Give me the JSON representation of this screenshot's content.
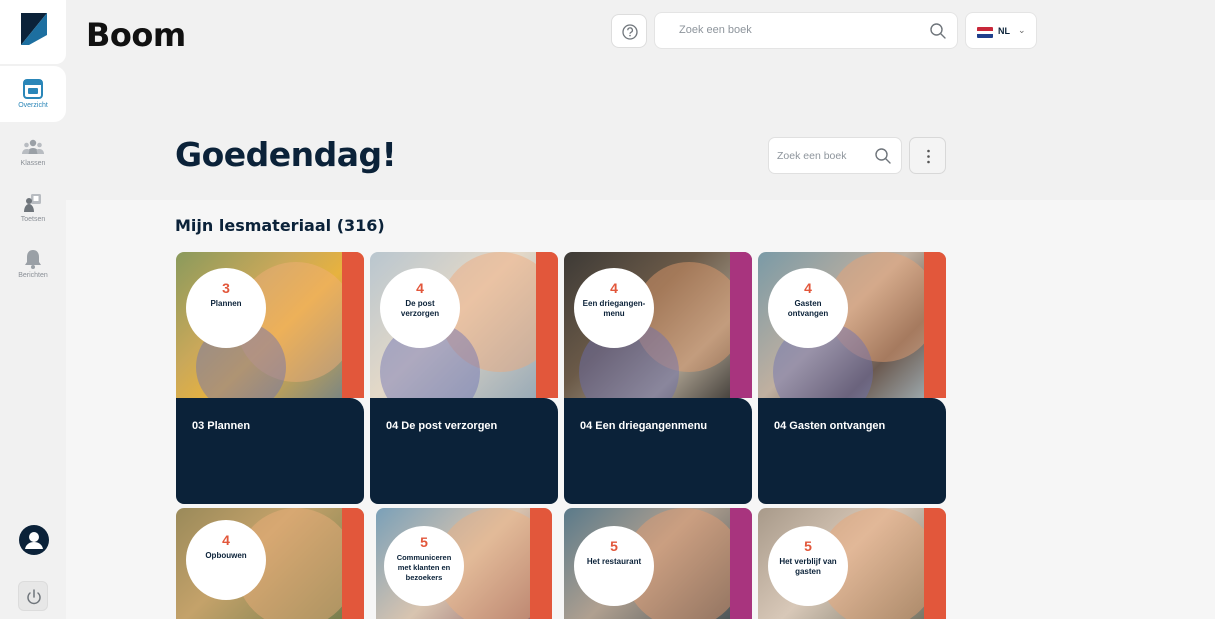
{
  "app": {
    "brand": "Boom"
  },
  "sidebar": {
    "items": [
      {
        "label": "Overzicht",
        "icon": "dashboard-icon",
        "active": true
      },
      {
        "label": "Klassen",
        "icon": "users-icon",
        "active": false
      },
      {
        "label": "Toetsen",
        "icon": "test-icon",
        "active": false
      },
      {
        "label": "Berichten",
        "icon": "bell-icon",
        "active": false
      }
    ]
  },
  "header": {
    "search_placeholder": "Zoek een boek",
    "language": "NL",
    "help_icon": "question-circle-icon"
  },
  "main": {
    "greeting": "Goedendag!",
    "search_placeholder": "Zoek een boek",
    "section_title": "Mijn lesmateriaal (316)"
  },
  "books": [
    {
      "number": "3",
      "cover_title": "Plannen",
      "title": "03 Plannen",
      "accent": "#e2573b"
    },
    {
      "number": "4",
      "cover_title": "De post verzorgen",
      "title": "04 De post verzorgen",
      "accent": "#e2573b"
    },
    {
      "number": "4",
      "cover_title": "Een driegangen-menu",
      "title": "04 Een driegangenmenu",
      "accent": "#a8347e"
    },
    {
      "number": "4",
      "cover_title": "Gasten ontvangen",
      "title": "04 Gasten ontvangen",
      "accent": "#e2573b"
    },
    {
      "number": "4",
      "cover_title": "Opbouwen",
      "title": "",
      "accent": "#e2573b"
    },
    {
      "number": "5",
      "cover_title": "Communiceren met klanten en bezoekers",
      "title": "",
      "accent": "#e2573b"
    },
    {
      "number": "5",
      "cover_title": "Het restaurant",
      "title": "",
      "accent": "#a8347e"
    },
    {
      "number": "5",
      "cover_title": "Het verblijf van gasten",
      "title": "",
      "accent": "#e2573b"
    }
  ],
  "colors": {
    "navy": "#0b2239",
    "orange": "#e2573b",
    "purple": "#a8347e",
    "active_blue": "#2a86b8"
  }
}
